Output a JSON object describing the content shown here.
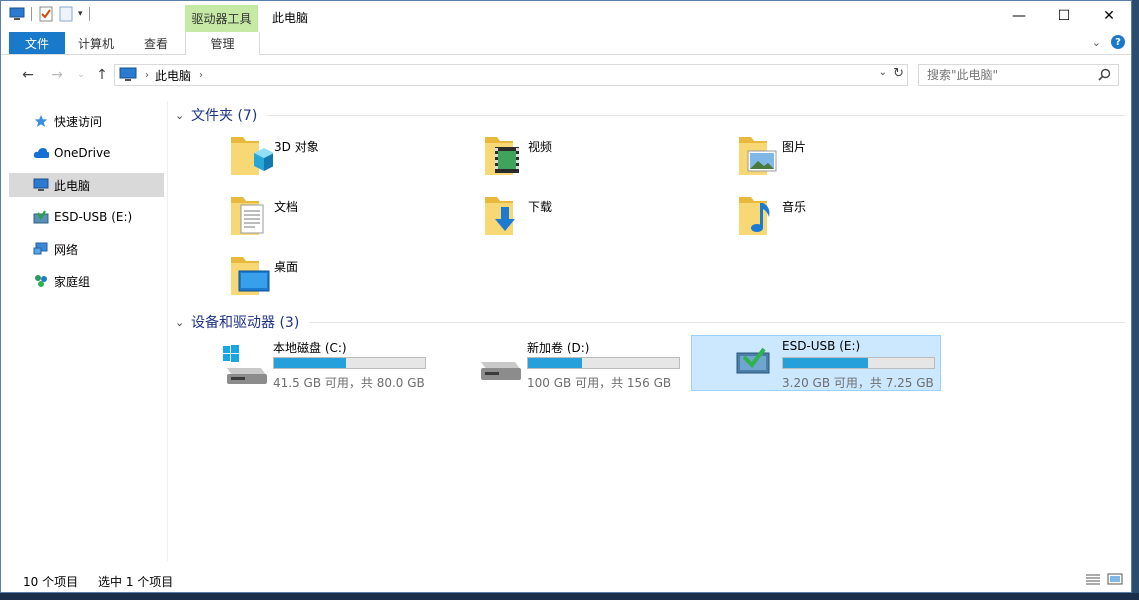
{
  "window": {
    "title": "此电脑",
    "context_tab_group": "驱动器工具",
    "controls": {
      "minimize": "—",
      "maximize": "☐",
      "close": "✕"
    }
  },
  "ribbon": {
    "tabs": [
      {
        "label": "文件"
      },
      {
        "label": "计算机"
      },
      {
        "label": "查看"
      },
      {
        "label": "管理"
      }
    ],
    "expand_icon": "chevron-down-icon",
    "help": "?"
  },
  "address": {
    "breadcrumb": "此电脑",
    "search_placeholder": "搜索\"此电脑\""
  },
  "nav_pane": {
    "items": [
      {
        "label": "快速访问",
        "icon": "star-icon"
      },
      {
        "label": "OneDrive",
        "icon": "cloud-icon"
      },
      {
        "label": "此电脑",
        "icon": "computer-icon",
        "selected": true
      },
      {
        "label": "ESD-USB (E:)",
        "icon": "usb-drive-icon"
      },
      {
        "label": "网络",
        "icon": "network-icon"
      },
      {
        "label": "家庭组",
        "icon": "homegroup-icon"
      }
    ]
  },
  "folders": {
    "header": "文件夹 (7)",
    "items": [
      {
        "name": "3D 对象",
        "icon": "3d-objects-folder-icon"
      },
      {
        "name": "视频",
        "icon": "videos-folder-icon"
      },
      {
        "name": "图片",
        "icon": "pictures-folder-icon"
      },
      {
        "name": "文档",
        "icon": "documents-folder-icon"
      },
      {
        "name": "下载",
        "icon": "downloads-folder-icon"
      },
      {
        "name": "音乐",
        "icon": "music-folder-icon"
      },
      {
        "name": "桌面",
        "icon": "desktop-folder-icon"
      }
    ]
  },
  "drives": {
    "header": "设备和驱动器 (3)",
    "items": [
      {
        "name": "本地磁盘 (C:)",
        "free": "41.5 GB 可用，共 80.0 GB",
        "used_fraction": 0.48,
        "icon": "windows-drive-icon"
      },
      {
        "name": "新加卷 (D:)",
        "free": "100 GB 可用，共 156 GB",
        "used_fraction": 0.36,
        "icon": "hard-drive-icon"
      },
      {
        "name": "ESD-USB (E:)",
        "free": "3.20 GB 可用，共 7.25 GB",
        "used_fraction": 0.56,
        "icon": "usb-setup-drive-icon",
        "selected": true
      }
    ]
  },
  "status": {
    "item_count": "10 个项目",
    "selected": "选中 1 个项目"
  },
  "colors": {
    "accent": "#1979ca",
    "context_tab": "#c7e9a6",
    "progress": "#26a0da",
    "selection": "#cce8ff",
    "group_title": "#1e3287"
  }
}
